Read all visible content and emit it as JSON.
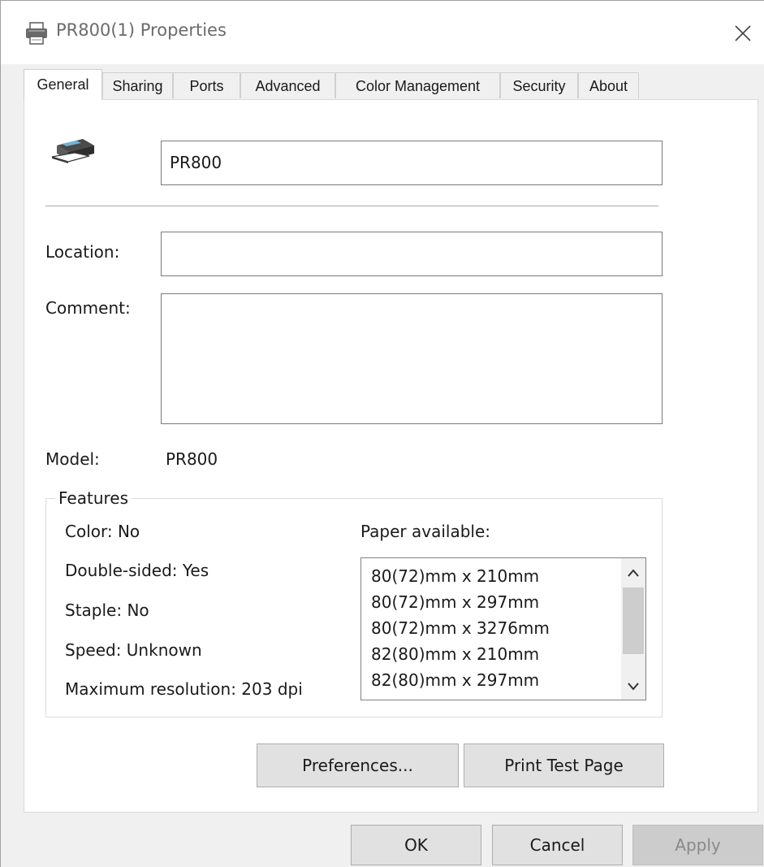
{
  "window": {
    "title": "PR800(1) Properties",
    "close_icon": "close-icon"
  },
  "tabs": [
    {
      "label": "General",
      "active": true
    },
    {
      "label": "Sharing",
      "active": false
    },
    {
      "label": "Ports",
      "active": false
    },
    {
      "label": "Advanced",
      "active": false
    },
    {
      "label": "Color Management",
      "active": false
    },
    {
      "label": "Security",
      "active": false
    },
    {
      "label": "About",
      "active": false
    }
  ],
  "general": {
    "printer_name": "PR800",
    "location_label": "Location:",
    "location_value": "",
    "comment_label": "Comment:",
    "comment_value": "",
    "model_label": "Model:",
    "model_value": "PR800"
  },
  "features": {
    "legend": "Features",
    "color": "Color: No",
    "double_sided": "Double-sided: Yes",
    "staple": "Staple: No",
    "speed": "Speed: Unknown",
    "max_resolution": "Maximum resolution: 203 dpi",
    "paper_label": "Paper available:",
    "paper_items": [
      "80(72)mm x 210mm",
      "80(72)mm x 297mm",
      "80(72)mm x 3276mm",
      "82(80)mm x 210mm",
      "82(80)mm x 297mm"
    ]
  },
  "buttons": {
    "preferences": "Preferences...",
    "print_test_page": "Print Test Page",
    "ok": "OK",
    "cancel": "Cancel",
    "apply": "Apply"
  },
  "colors": {
    "window_bg": "#f0f0f0",
    "panel_bg": "#ffffff",
    "button_bg": "#e1e1e1",
    "disabled_text": "#8a8a8a"
  }
}
